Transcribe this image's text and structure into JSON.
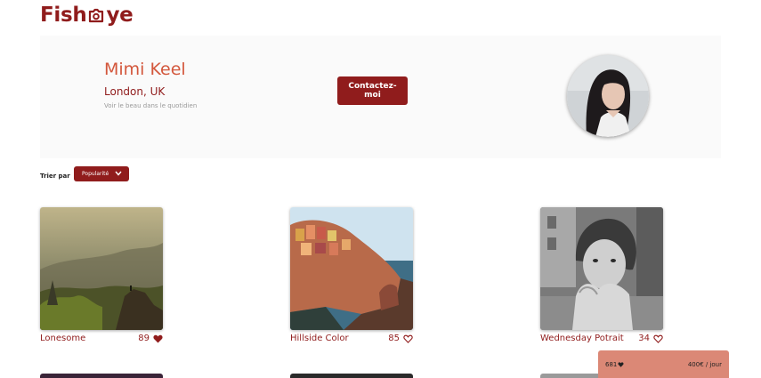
{
  "logo": {
    "text_left": "Fish",
    "text_right": "ye"
  },
  "photographer": {
    "name": "Mimi Keel",
    "location": "London, UK",
    "tagline": "Voir le beau dans le quotidien"
  },
  "contact_button": {
    "label": "Contactez-moi"
  },
  "sort": {
    "label": "Trier par",
    "selected": "Popularité"
  },
  "gallery": [
    {
      "title": "Lonesome",
      "likes": 89,
      "liked": true
    },
    {
      "title": "Hillside Color",
      "likes": 85,
      "liked": false
    },
    {
      "title": "Wednesday Potrait",
      "likes": 34,
      "liked": false
    }
  ],
  "summary": {
    "total_likes": "681",
    "price": "400€ / jour"
  },
  "colors": {
    "primary": "#901c1c",
    "accent": "#d3573c",
    "sticky_bg": "#db8876",
    "header_bg": "#fafafa"
  }
}
